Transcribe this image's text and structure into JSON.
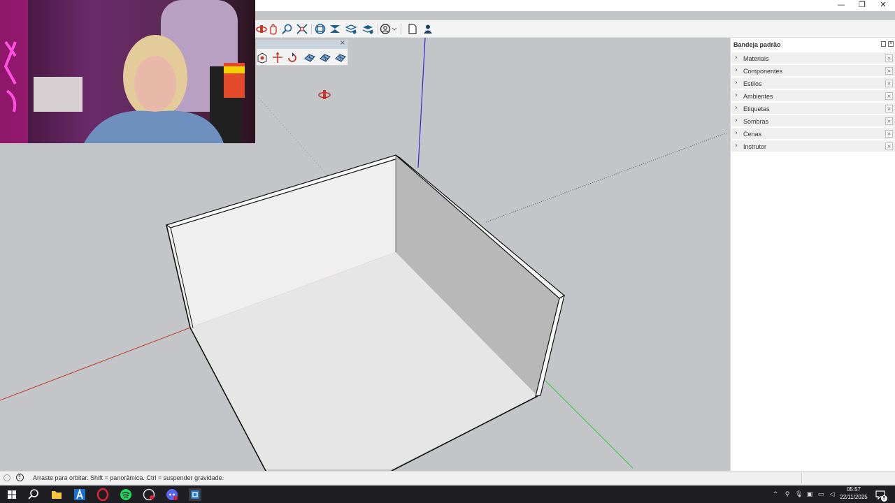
{
  "window": {
    "minimize": "—",
    "restore": "❐",
    "close": "✕"
  },
  "tray": {
    "title": "Bandeja padrão",
    "items": [
      {
        "label": "Materiais"
      },
      {
        "label": "Componentes"
      },
      {
        "label": "Estilos"
      },
      {
        "label": "Ambientes"
      },
      {
        "label": "Etiquetas"
      },
      {
        "label": "Sombras"
      },
      {
        "label": "Cenas"
      },
      {
        "label": "Instrutor"
      }
    ]
  },
  "status": {
    "hint": "Arraste para orbitar. Shift = panorâmica. Ctrl = suspender gravidade.",
    "info_icon": "!"
  },
  "clock": {
    "time": "05:57",
    "date": "22/11/2025"
  },
  "notification_count": "9",
  "colors": {
    "viewport": "#c4c5c9",
    "red_axis": "#c0392b",
    "green_axis": "#2ecc40",
    "blue_axis": "#2222cc",
    "toolbar_icon": "#1b5e8c"
  },
  "icons": {
    "toolbar": [
      "orbit-icon",
      "pan-icon",
      "zoom-icon",
      "zoom-extents-icon",
      "section-plane-icon",
      "section-display-icon",
      "section-cut-icon",
      "section-fill-icon",
      "account-icon",
      "new-file-icon",
      "user-icon"
    ],
    "floating": [
      "warehouse-icon",
      "move-icon",
      "rotate-icon",
      "sandbox-1-icon",
      "sandbox-2-icon",
      "sandbox-3-icon"
    ],
    "taskbar": [
      "windows-start-icon",
      "search-icon",
      "file-explorer-icon",
      "app-a-icon",
      "opera-gx-icon",
      "spotify-icon",
      "app-recorder-icon",
      "discord-icon",
      "sketchup-icon"
    ]
  }
}
